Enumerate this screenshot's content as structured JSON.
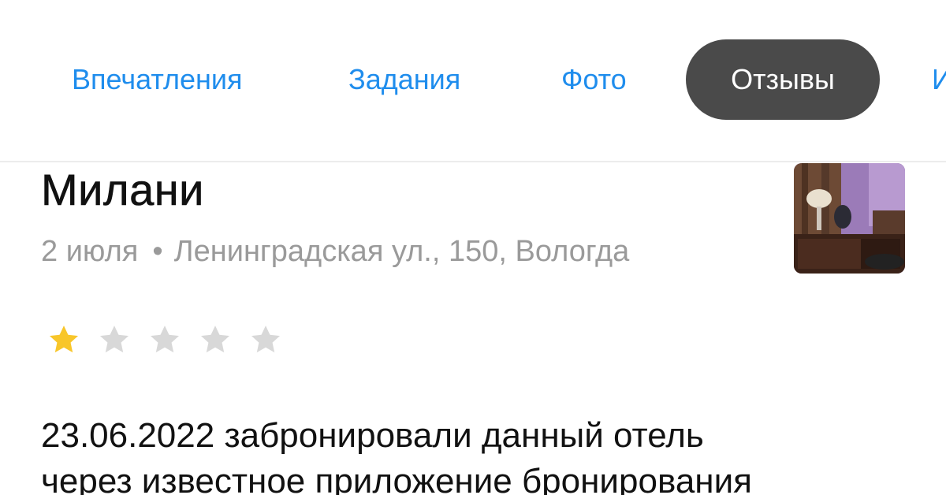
{
  "tabs": [
    {
      "label": "Впечатления"
    },
    {
      "label": "Задания"
    },
    {
      "label": "Фото"
    },
    {
      "label": "Отзывы",
      "active": true
    },
    {
      "label": "И"
    }
  ],
  "review": {
    "author": "Милани",
    "date": "2 июля",
    "separator": "•",
    "address": "Ленинградская ул., 150, Вологда",
    "rating": 1,
    "rating_max": 5,
    "text_line_1": "23.06.2022 забронировали данный отель",
    "text_line_2": "через известное приложение бронирования"
  },
  "colors": {
    "tab_link": "#1f8ded",
    "tab_active_bg": "#4a4a4a",
    "star_filled": "#f8c62a",
    "star_empty": "#d8d8d8"
  },
  "icons": {
    "star_filled": "star-filled-icon",
    "star_empty": "star-empty-icon"
  }
}
